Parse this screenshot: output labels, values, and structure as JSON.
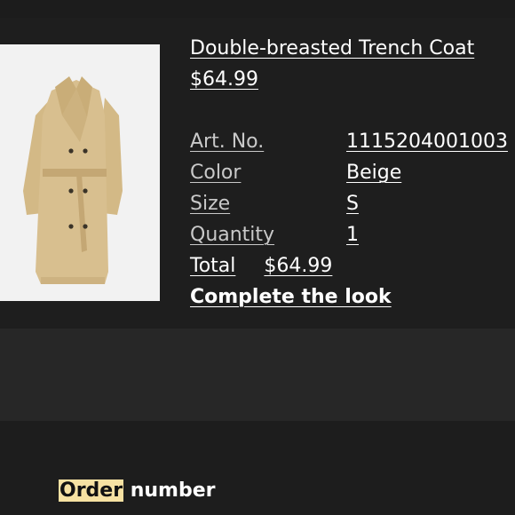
{
  "product": {
    "name": "Double-breasted Trench Coat",
    "price": "$64.99",
    "details": [
      {
        "label": "Art. No.",
        "value": "1115204001003"
      },
      {
        "label": "Color",
        "value": "Beige"
      },
      {
        "label": "Size",
        "value": "S"
      },
      {
        "label": "Quantity",
        "value": "1"
      }
    ],
    "total_label": "Total",
    "total_value": "$64.99",
    "complete_the_look": "Complete the look"
  },
  "order": {
    "highlight": "Order",
    "rest": " number"
  },
  "colors": {
    "background": "#232323",
    "card": "#1e1e1e",
    "highlight": "#f6e1a2",
    "coat": "#d6bd8c"
  }
}
